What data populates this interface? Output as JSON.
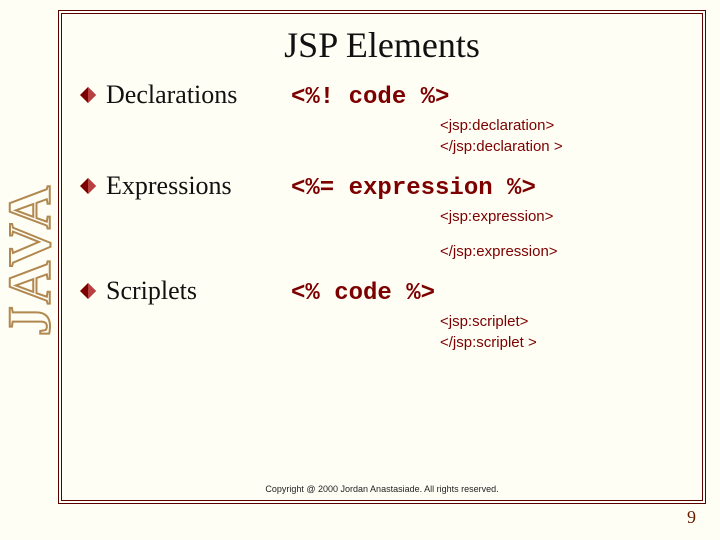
{
  "banner_text": "JAVA",
  "title": "JSP Elements",
  "items": [
    {
      "label": "Declarations",
      "syntax": "<%! code %>",
      "open_tag": "<jsp:declaration>",
      "close_tag": "</jsp:declaration >",
      "split": false
    },
    {
      "label": "Expressions",
      "syntax": "<%= expression %>",
      "open_tag": "<jsp:expression>",
      "close_tag": "</jsp:expression>",
      "split": true
    },
    {
      "label": "Scriplets",
      "syntax": "<% code %>",
      "open_tag": "<jsp:scriplet>",
      "close_tag": "</jsp:scriplet >",
      "split": false
    }
  ],
  "copyright": "Copyright @ 2000 Jordan Anastasiade.  All rights reserved.",
  "page_number": "9",
  "colors": {
    "accent": "#7c0000",
    "frame": "#5a0000",
    "paper": "#fffef5"
  }
}
